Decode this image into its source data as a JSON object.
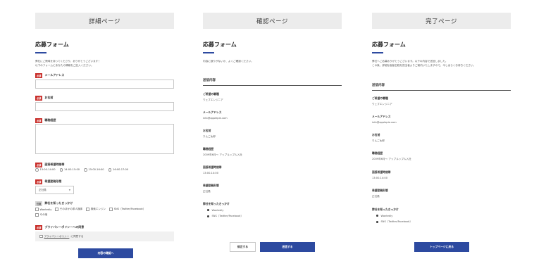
{
  "detail": {
    "banner": "詳細ページ",
    "form_title": "応募フォーム",
    "intro_1": "弊社にご興味を持ってくださり、ありがとうございます！",
    "intro_2": "以下のフォームにあなたの情報をご記入ください。",
    "required_tag": "必須",
    "optional_tag": "任意",
    "email_label": "メールアドレス",
    "name_label": "お名前",
    "career_label": "職務経歴",
    "interview_label": "面接希望時間帯",
    "interview_options": [
      "13:00-14:00",
      "14:00-15:00",
      "15:00-16:00",
      "16:00-17:00"
    ],
    "employment_label": "希望勤務形態",
    "employment_value": "正社員",
    "source_label": "弊社を知ったきっかけ",
    "source_options": [
      "Wantedly",
      "そのほかの求人媒体",
      "検索エンジン",
      "SNS（Twitter/Facebook）",
      "その他"
    ],
    "privacy_label": "プライバシーポリシーへの同意",
    "privacy_link": "プライバシーポリシー",
    "privacy_suffix": "に同意する",
    "submit_button": "内容の確認へ"
  },
  "confirm": {
    "banner": "確認ページ",
    "form_title": "応募フォーム",
    "intro": "内容に誤りがないか、よくご確認ください。",
    "section_heading": "送信内容",
    "items": [
      {
        "label": "ご希望の職種",
        "value": "ウェブエンジニア"
      },
      {
        "label": "メールアドレス",
        "value": "info@applepie.com"
      },
      {
        "label": "お名前",
        "value": "りんご太郎"
      },
      {
        "label": "職務経歴",
        "value": "2009年6月〜 アップルップル入社"
      },
      {
        "label": "面接希望時間帯",
        "value": "13:00-14:00"
      },
      {
        "label": "希望勤務形態",
        "value": "正社員"
      },
      {
        "label": "弊社を知ったきっかけ",
        "value": ""
      }
    ],
    "source_values": [
      "Wantedly",
      "SNS（Twitter/Facebook）"
    ],
    "back_button": "修正する",
    "send_button": "送信する"
  },
  "complete": {
    "banner": "完了ページ",
    "form_title": "応募フォーム",
    "intro_1": "弊社へご応募ありがとうございます。以下の内容で送信しました。",
    "intro_2": "この後、詳細な面接日程を担当者よりご案内いたしますので、今しばらくお待ちください。",
    "section_heading": "送信内容",
    "items": [
      {
        "label": "ご希望の職種",
        "value": "ウェブエンジニア"
      },
      {
        "label": "メールアドレス",
        "value": "info@applepie.com"
      },
      {
        "label": "お名前",
        "value": "りんご太郎"
      },
      {
        "label": "職務経歴",
        "value": "2009年6月〜 アップルップル入社"
      },
      {
        "label": "面接希望時間帯",
        "value": "13:00-14:00"
      },
      {
        "label": "希望勤務形態",
        "value": "正社員"
      },
      {
        "label": "弊社を知ったきっかけ",
        "value": ""
      }
    ],
    "source_values": [
      "Wantedly",
      "SNS（Twitter/Facebook）"
    ],
    "top_button": "トップページに戻る"
  },
  "colors": {
    "accent": "#2d4aa0",
    "required": "#c9302c",
    "banner_bg": "#ececec"
  }
}
